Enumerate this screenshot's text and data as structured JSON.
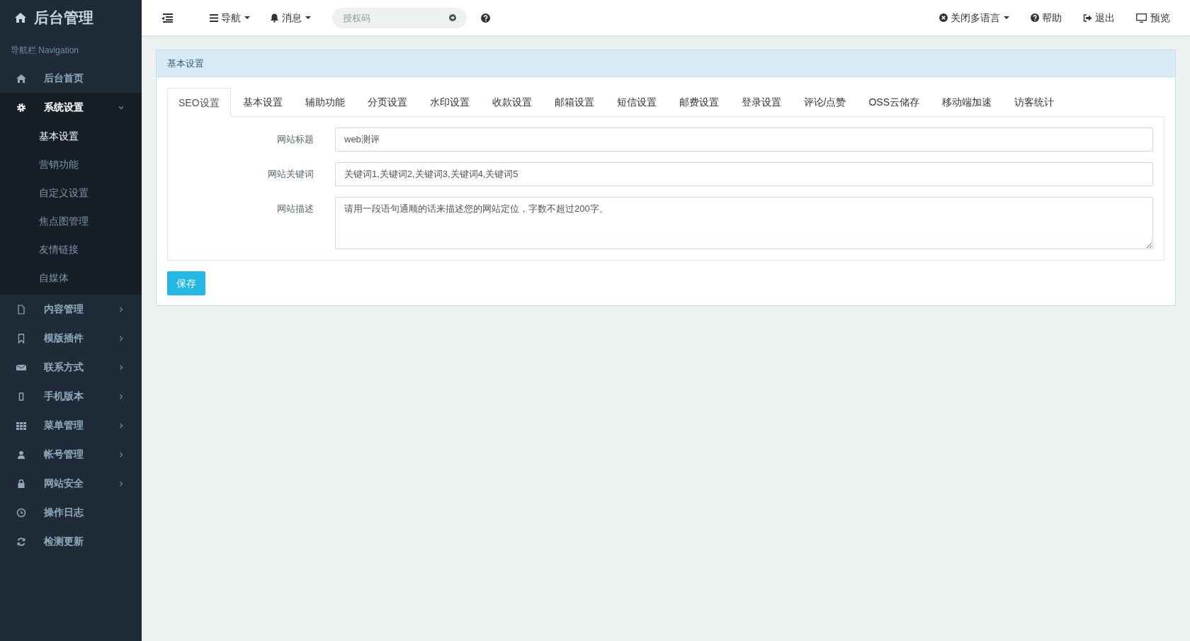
{
  "brand": {
    "title": "后台管理"
  },
  "sidebar": {
    "heading": "导航栏 Navigation",
    "items": [
      {
        "label": "后台首页",
        "kind": "link",
        "selected": false
      },
      {
        "label": "系统设置",
        "kind": "group",
        "expanded": true,
        "selected": true,
        "children": [
          {
            "label": "基本设置",
            "selected": true
          },
          {
            "label": "营销功能",
            "selected": false
          },
          {
            "label": "自定义设置",
            "selected": false
          },
          {
            "label": "焦点图管理",
            "selected": false
          },
          {
            "label": "友情链接",
            "selected": false
          },
          {
            "label": "自媒体",
            "selected": false
          }
        ]
      },
      {
        "label": "内容管理",
        "kind": "group",
        "expanded": false,
        "selected": false
      },
      {
        "label": "模版插件",
        "kind": "group",
        "expanded": false,
        "selected": false
      },
      {
        "label": "联系方式",
        "kind": "group",
        "expanded": false,
        "selected": false
      },
      {
        "label": "手机版本",
        "kind": "group",
        "expanded": false,
        "selected": false
      },
      {
        "label": "菜单管理",
        "kind": "group",
        "expanded": false,
        "selected": false
      },
      {
        "label": "帐号管理",
        "kind": "group",
        "expanded": false,
        "selected": false
      },
      {
        "label": "网站安全",
        "kind": "group",
        "expanded": false,
        "selected": false
      },
      {
        "label": "操作日志",
        "kind": "link",
        "selected": false
      },
      {
        "label": "检测更新",
        "kind": "link",
        "selected": false
      }
    ]
  },
  "topbar": {
    "left": [
      {
        "label": "导航",
        "dropdown": true
      },
      {
        "label": "消息",
        "dropdown": true
      }
    ],
    "search": {
      "placeholder": "授权码"
    },
    "right": [
      {
        "label": "关闭多语言",
        "dropdown": true
      },
      {
        "label": "帮助",
        "dropdown": false
      },
      {
        "label": "退出",
        "dropdown": false
      },
      {
        "label": "预览",
        "dropdown": false
      }
    ]
  },
  "panel": {
    "title": "基本设置",
    "tabs": [
      {
        "label": "SEO设置",
        "selected": true
      },
      {
        "label": "基本设置",
        "selected": false
      },
      {
        "label": "辅助功能",
        "selected": false
      },
      {
        "label": "分页设置",
        "selected": false
      },
      {
        "label": "水印设置",
        "selected": false
      },
      {
        "label": "收款设置",
        "selected": false
      },
      {
        "label": "邮箱设置",
        "selected": false
      },
      {
        "label": "短信设置",
        "selected": false
      },
      {
        "label": "邮费设置",
        "selected": false
      },
      {
        "label": "登录设置",
        "selected": false
      },
      {
        "label": "评论/点赞",
        "selected": false
      },
      {
        "label": "OSS云储存",
        "selected": false
      },
      {
        "label": "移动端加速",
        "selected": false
      },
      {
        "label": "访客统计",
        "selected": false
      }
    ],
    "fields": [
      {
        "label": "网站标题",
        "kind": "input",
        "value": "web测评"
      },
      {
        "label": "网站关键词",
        "kind": "input",
        "value": "关键词1,关键词2,关键词3,关键词4,关键词5"
      },
      {
        "label": "网站描述",
        "kind": "textarea",
        "value": "请用一段语句通顺的话来描述您的网站定位，字数不超过200字。"
      }
    ],
    "save_button": "保存"
  }
}
